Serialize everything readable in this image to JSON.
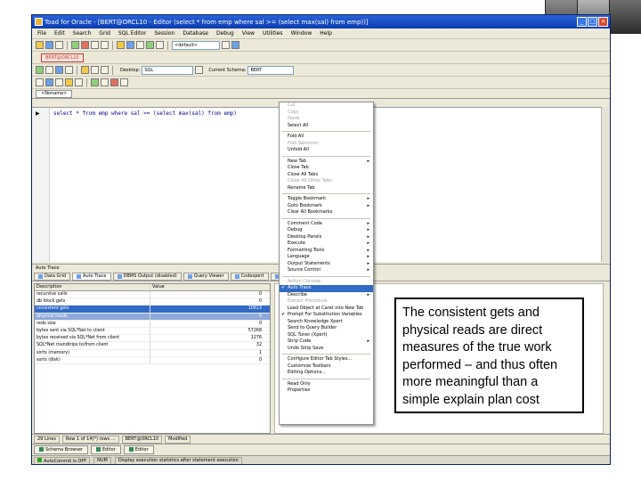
{
  "window": {
    "title": "Toad for Oracle - [BERT@ORCL10 - Editor (select * from emp where sal >= (select max(sal) from emp))]",
    "buttons": [
      "_",
      "□",
      "×"
    ]
  },
  "menu": [
    "File",
    "Edit",
    "Search",
    "Grid",
    "SQL Editor",
    "Session",
    "Database",
    "Debug",
    "View",
    "Utilities",
    "Window",
    "Help"
  ],
  "toolbar": {
    "schema_combo": "<default>",
    "desktop_label": "Desktop:",
    "desktop_value": "SQL",
    "schema_label": "Current Schema:",
    "schema_value": "BERT"
  },
  "connection_tab": "BERT@ORCL10",
  "doc_tab": "<Noname>",
  "editor": {
    "sql_text": "select * from emp where sal >= (select max(sal) from emp)"
  },
  "trace": {
    "header": "Auto Trace",
    "tabs": [
      "Data Grid",
      "Auto Trace",
      "DBMS Output (disabled)",
      "Query Viewer",
      "Codexpert",
      "Expl"
    ],
    "columns": [
      "Description",
      "Value"
    ],
    "rows": [
      {
        "name": "recursive calls",
        "value": "0"
      },
      {
        "name": "db block gets",
        "value": "0"
      },
      {
        "name": "consistent gets",
        "value": "10613"
      },
      {
        "name": "physical reads",
        "value": "0"
      },
      {
        "name": "redo size",
        "value": "0"
      },
      {
        "name": "bytes sent via SQL*Net to client",
        "value": "57268"
      },
      {
        "name": "bytes received via SQL*Net from client",
        "value": "1276"
      },
      {
        "name": "SQL*Net roundtrips to/from client",
        "value": "32"
      },
      {
        "name": "sorts (memory)",
        "value": "1"
      },
      {
        "name": "sorts (disk)",
        "value": "0"
      }
    ]
  },
  "context_menu": [
    {
      "label": "Cut",
      "disabled": true
    },
    {
      "label": "Copy",
      "disabled": true
    },
    {
      "label": "Paste",
      "disabled": true
    },
    {
      "label": "Select All"
    },
    {
      "sep": true
    },
    {
      "label": "Fold All"
    },
    {
      "label": "Fold Selection",
      "disabled": true
    },
    {
      "label": "Unfold All"
    },
    {
      "sep": true
    },
    {
      "label": "New Tab",
      "sub": true
    },
    {
      "label": "Close Tab"
    },
    {
      "label": "Close All Tabs"
    },
    {
      "label": "Close All Other Tabs",
      "disabled": true
    },
    {
      "label": "Rename Tab"
    },
    {
      "sep": true
    },
    {
      "label": "Toggle Bookmark",
      "sub": true
    },
    {
      "label": "Goto Bookmark",
      "sub": true
    },
    {
      "label": "Clear All Bookmarks"
    },
    {
      "sep": true
    },
    {
      "label": "Comment Code",
      "sub": true
    },
    {
      "label": "Debug",
      "sub": true
    },
    {
      "label": "Desktop Panels",
      "sub": true
    },
    {
      "label": "Execute",
      "sub": true
    },
    {
      "label": "Formatting Tools",
      "sub": true
    },
    {
      "label": "Language",
      "sub": true
    },
    {
      "label": "Output Statements",
      "sub": true
    },
    {
      "label": "Source Control",
      "sub": true
    },
    {
      "sep": true
    },
    {
      "label": "Action Console",
      "disabled": true
    },
    {
      "label": "Auto Trace",
      "checked": true,
      "highlight": true
    },
    {
      "label": "Describe",
      "sub": true
    },
    {
      "label": "Extract Procedure",
      "disabled": true
    },
    {
      "label": "Load Object at Caret into New Tab"
    },
    {
      "label": "Prompt For Substitution Variables",
      "checked": true
    },
    {
      "label": "Search Knowledge Xpert"
    },
    {
      "label": "Send to Query Builder"
    },
    {
      "label": "SQL Tuner (Xpert)"
    },
    {
      "label": "Strip Code",
      "sub": true
    },
    {
      "label": "Undo Strip Save"
    },
    {
      "sep": true
    },
    {
      "label": "Configure Editor Tab Styles..."
    },
    {
      "label": "Customize Toolbars"
    },
    {
      "label": "Editing Options..."
    },
    {
      "sep": true
    },
    {
      "label": "Read Only"
    },
    {
      "label": "Properties"
    }
  ],
  "status": {
    "cells": [
      "29 Lines",
      "Row 1 of 14(*) rows ...",
      "BERT@ORCL10",
      "Modified"
    ],
    "task_buttons": [
      "Schema Browser",
      "Editor",
      "Editor"
    ],
    "bottom": [
      "AutoCommit is OFF",
      "NUM",
      "Display execution statistics after statement execution"
    ]
  },
  "callout": "The consistent gets and physical reads are direct measures of the true work performed – and thus often more meaningful than a simple explain plan cost"
}
